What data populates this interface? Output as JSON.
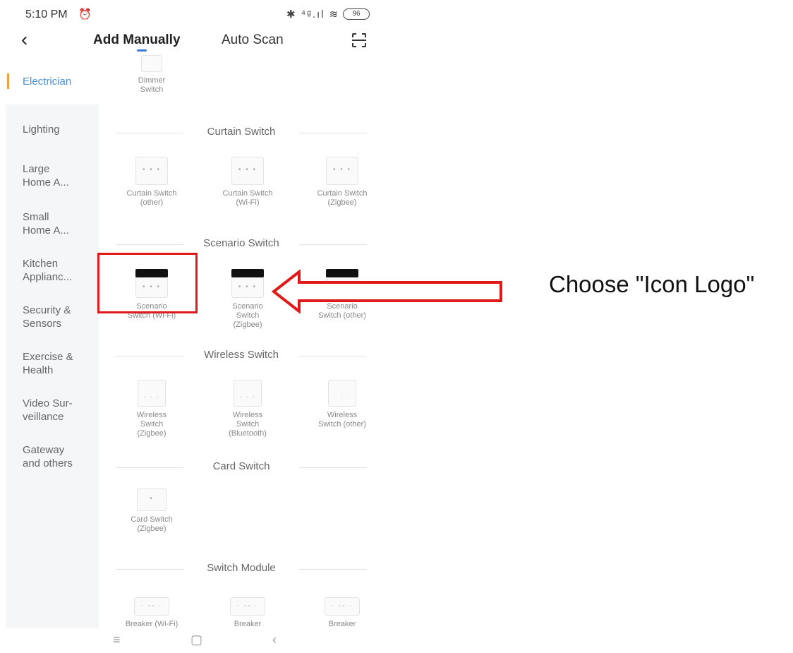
{
  "status_bar": {
    "time": "5:10 PM",
    "right_icons": "✱ ⁴ᵍ.ıl ≋",
    "battery": "96"
  },
  "header": {
    "tab_add_manually": "Add Manually",
    "tab_auto_scan": "Auto Scan"
  },
  "sidebar": {
    "items": [
      {
        "label": "Electrician",
        "active": true
      },
      {
        "label": "Lighting"
      },
      {
        "label": "Large\nHome A..."
      },
      {
        "label": "Small\nHome A..."
      },
      {
        "label": "Kitchen\nApplianc..."
      },
      {
        "label": "Security &\nSensors"
      },
      {
        "label": "Exercise &\nHealth"
      },
      {
        "label": "Video Sur-\nveillance"
      },
      {
        "label": "Gateway\nand others"
      }
    ]
  },
  "content": {
    "top_device": "Dimmer\nSwitch",
    "sections": [
      {
        "title": "Curtain Switch",
        "devices": [
          "Curtain Switch\n(other)",
          "Curtain Switch\n(Wi-Fi)",
          "Curtain Switch\n(Zigbee)"
        ]
      },
      {
        "title": "Scenario Switch",
        "devices": [
          "Scenario\nSwitch (Wi-Fi)",
          "Scenario\nSwitch\n(Zigbee)",
          "Scenario\nSwitch (other)"
        ]
      },
      {
        "title": "Wireless Switch",
        "devices": [
          "Wireless\nSwitch\n(Zigbee)",
          "Wireless\nSwitch\n(Bluetooth)",
          "Wireless\nSwitch (other)"
        ]
      },
      {
        "title": "Card Switch",
        "devices": [
          "Card Switch\n(Zigbee)"
        ]
      },
      {
        "title": "Switch Module",
        "devices": [
          "Breaker (Wi-Fi)",
          "Breaker",
          "Breaker"
        ]
      }
    ]
  },
  "annotation": {
    "callout": "Choose \"Icon Logo\"",
    "color": "#e01a1a"
  }
}
